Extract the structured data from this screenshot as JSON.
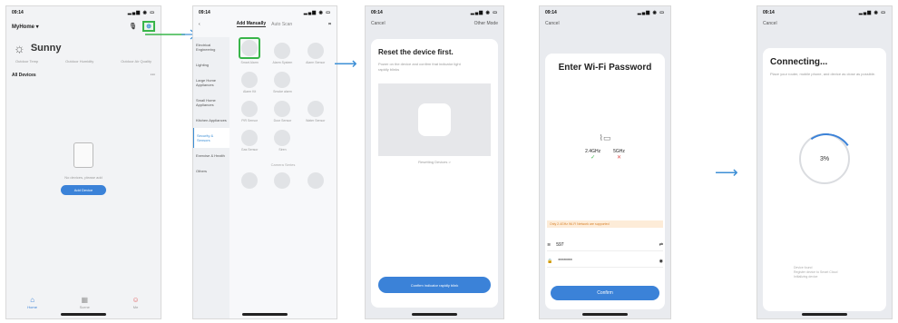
{
  "status_time": "09:14",
  "phone1": {
    "home_name": "MyHome",
    "weather": "Sunny",
    "stats": [
      "Outdoor Temp",
      "Outdoor Humidity",
      "Outdoor Air Quality"
    ],
    "all_devices": "All Devices",
    "empty_text": "No devices, please add",
    "add_device": "Add Device",
    "tabs": [
      "Home",
      "Scene",
      "Me"
    ]
  },
  "phone2": {
    "tab_add_manually": "Add Manually",
    "tab_auto_scan": "Auto Scan",
    "categories": [
      "Electrical Engineering",
      "Lighting",
      "Large Home Appliances",
      "Small Home Appliances",
      "Kitchen Appliances",
      "Security & Sensors",
      "Exercise & Health",
      "Others"
    ],
    "selected_category": "Security & Sensors",
    "grid_items": [
      "Smart Alarm",
      "Alarm System",
      "Alarm Sensor",
      "Alarm Kit",
      "Smoke alarm",
      "PIR Sensor",
      "Door Sensor",
      "Water Sensor",
      "Gas Sensor",
      "Siren"
    ],
    "section": "Camera Series"
  },
  "phone3": {
    "cancel": "Cancel",
    "other_mode": "Other Mode",
    "title": "Reset the device first.",
    "body": "Power on the device and confirm that indicator light rapidly blinks",
    "image_caption": "Resetting Devices >",
    "confirm": "Confirm indicator rapidly blink"
  },
  "phone4": {
    "cancel": "Cancel",
    "title": "Enter Wi-Fi Password",
    "band_24": "2.4GHz",
    "band_5": "5GHz",
    "notice": "Only 2.4GHz Wi-Fi Network are supported",
    "ssid": "597",
    "password": "********",
    "next": "Confirm"
  },
  "phone5": {
    "cancel": "Cancel",
    "title": "Connecting...",
    "body": "Place your router, mobile phone, and device as close as possible.",
    "percent": "3%",
    "steps": [
      "Device found",
      "Register device to Smart Cloud",
      "Initializing device"
    ]
  }
}
